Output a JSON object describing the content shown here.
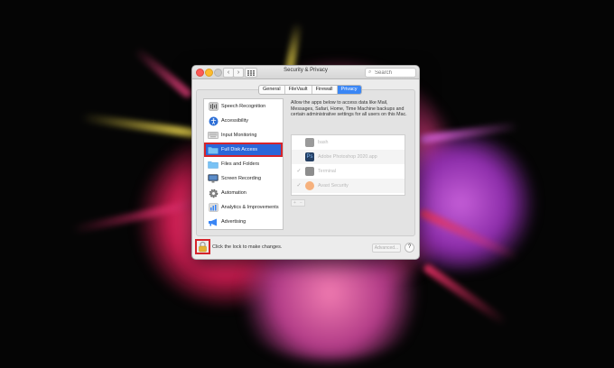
{
  "window": {
    "title": "Security & Privacy",
    "search_placeholder": "Search",
    "nav_back": "‹",
    "nav_forward": "›",
    "grid_icon": "grid-icon"
  },
  "tabs": [
    {
      "label": "General"
    },
    {
      "label": "FileVault"
    },
    {
      "label": "Firewall"
    },
    {
      "label": "Privacy",
      "active": true
    }
  ],
  "sidebar": {
    "items": [
      {
        "label": "Speech Recognition",
        "icon": "speech-icon"
      },
      {
        "label": "Accessibility",
        "icon": "accessibility-icon"
      },
      {
        "label": "Input Monitoring",
        "icon": "keyboard-icon"
      },
      {
        "label": "Full Disk Access",
        "icon": "folder-icon",
        "selected": true
      },
      {
        "label": "Files and Folders",
        "icon": "folder-icon"
      },
      {
        "label": "Screen Recording",
        "icon": "monitor-icon"
      },
      {
        "label": "Automation",
        "icon": "gear-icon"
      },
      {
        "label": "Analytics & Improvements",
        "icon": "chart-icon"
      },
      {
        "label": "Advertising",
        "icon": "megaphone-icon"
      }
    ]
  },
  "content": {
    "description": "Allow the apps below to access data like Mail, Messages, Safari, Home, Time Machine backups and certain administrative settings for all users on this Mac.",
    "apps": [
      {
        "name": "bash",
        "checked": false
      },
      {
        "name": "Adobe Photoshop 2020.app",
        "checked": false
      },
      {
        "name": "Terminal",
        "checked": true
      },
      {
        "name": "Avast Security",
        "checked": true
      }
    ],
    "add_label": "+",
    "remove_label": "−"
  },
  "footer": {
    "lock_text": "Click the lock to make changes.",
    "advanced_label": "Advanced...",
    "help_label": "?"
  },
  "colors": {
    "accent": "#2a66d9",
    "highlight": "#d5242b"
  }
}
